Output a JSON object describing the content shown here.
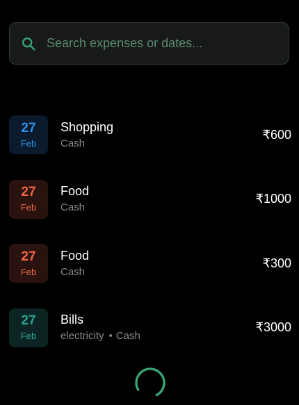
{
  "search": {
    "placeholder": "Search expenses or dates...",
    "icon": "search-icon"
  },
  "colors": {
    "accent": "#3aa376",
    "shopping": "#2e93e8",
    "food": "#f26447",
    "bills": "#2fa394"
  },
  "expenses": [
    {
      "day": "27",
      "month": "Feb",
      "category": "Shopping",
      "note": "",
      "payment": "Cash",
      "amount": "₹600",
      "color_key": "shopping"
    },
    {
      "day": "27",
      "month": "Feb",
      "category": "Food",
      "note": "",
      "payment": "Cash",
      "amount": "₹1000",
      "color_key": "food"
    },
    {
      "day": "27",
      "month": "Feb",
      "category": "Food",
      "note": "",
      "payment": "Cash",
      "amount": "₹300",
      "color_key": "food"
    },
    {
      "day": "27",
      "month": "Feb",
      "category": "Bills",
      "note": "electricity",
      "separator": "•",
      "payment": "Cash",
      "amount": "₹3000",
      "color_key": "bills"
    }
  ],
  "loading": {
    "icon": "loading-spinner-icon"
  }
}
